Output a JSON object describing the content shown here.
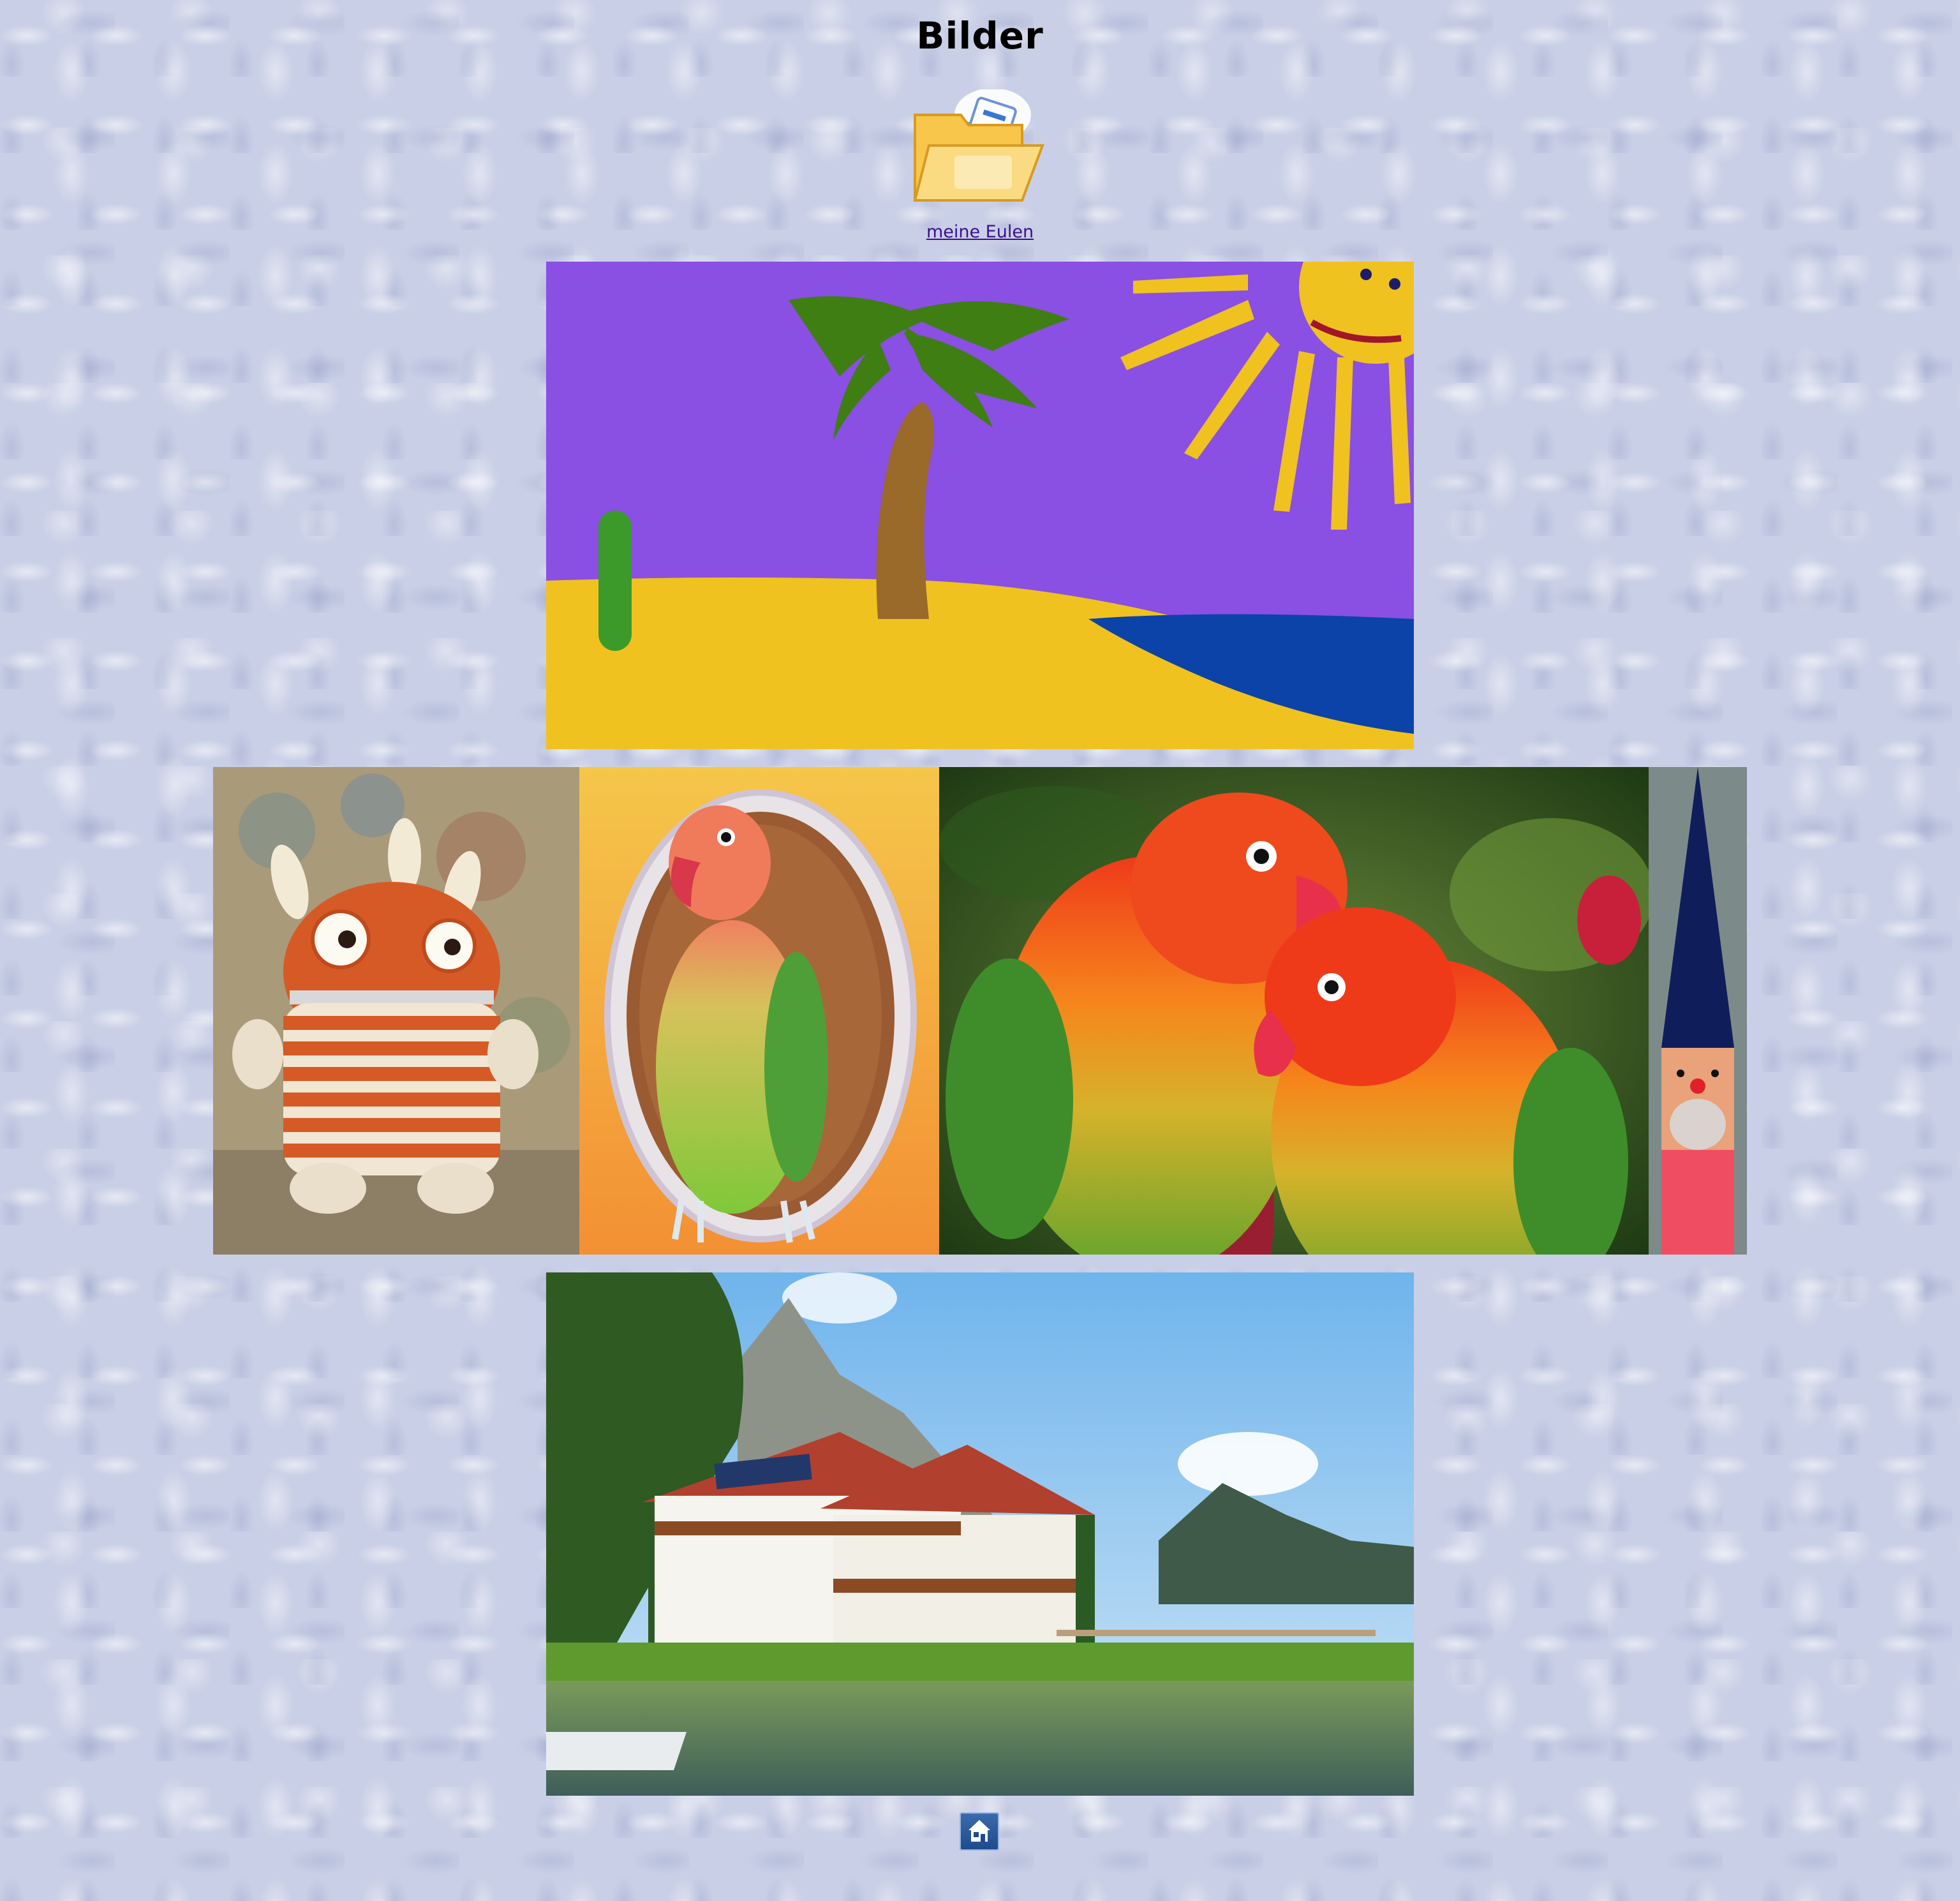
{
  "page": {
    "title": "Bilder"
  },
  "nav": {
    "owl_link_label": "meine Eulen",
    "folder_icon": "folder-documents-icon",
    "home_icon": "home-icon"
  },
  "gallery": {
    "beach_painting": "beach-painting-image",
    "monster_plush": "monster-plush-image",
    "parrot_single": "lovebird-portrait-image",
    "parrots_pair": "lovebirds-pair-image",
    "gnome_craft": "wooden-gnome-image",
    "hotel_lake": "lakeside-hotel-image"
  },
  "colors": {
    "link": "#3b0f8f",
    "background": "#c9cfe6"
  }
}
